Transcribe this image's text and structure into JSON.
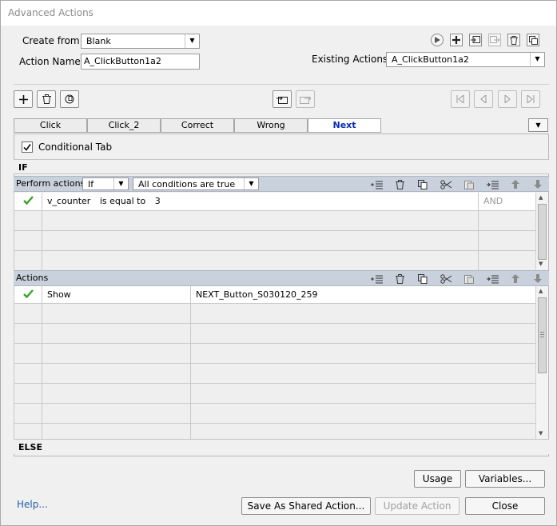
{
  "window": {
    "title": "Advanced Actions"
  },
  "form": {
    "create_from_label": "Create from:",
    "create_from_value": "Blank",
    "action_name_label": "Action Name:",
    "action_name_value": "A_ClickButton1a2",
    "existing_actions_label": "Existing Actions:",
    "existing_actions_value": "A_ClickButton1a2"
  },
  "tabs": [
    {
      "label": "Click"
    },
    {
      "label": "Click_2"
    },
    {
      "label": "Correct"
    },
    {
      "label": "Wrong"
    },
    {
      "label": "Next",
      "active": true
    }
  ],
  "conditional": {
    "label": "Conditional Tab",
    "checked": true
  },
  "if_section": {
    "header": "IF",
    "perform_label": "Perform actions:",
    "perform_value": "If",
    "conditions_value": "All conditions are true",
    "rows": [
      {
        "variable": "v_counter",
        "operator": "is equal to",
        "value": "3",
        "join": "AND"
      }
    ]
  },
  "actions_section": {
    "header": "Actions",
    "rows": [
      {
        "action": "Show",
        "target": "NEXT_Button_S030120_259"
      }
    ]
  },
  "else_section": {
    "header": "ELSE"
  },
  "buttons": {
    "usage": "Usage",
    "variables": "Variables...",
    "help": "Help...",
    "save_shared": "Save As Shared Action...",
    "update_action": "Update Action",
    "close": "Close"
  },
  "colors": {
    "accent": "#0a2bb3",
    "check": "#3aa12b",
    "toolbar_bg": "#c9d1dc",
    "link": "#1f5fa8"
  },
  "icons": {
    "preview": "play-icon",
    "add": "plus-icon",
    "delete": "trash-icon",
    "duplicate": "copy-icon",
    "cut": "scissors-icon",
    "paste": "paste-icon",
    "insert": "insert-row-icon",
    "move_up": "arrow-up-icon",
    "move_down": "arrow-down-icon",
    "first": "first-icon",
    "prev": "prev-icon",
    "next": "next-icon",
    "last": "last-icon",
    "import": "import-icon",
    "export": "export-icon"
  }
}
